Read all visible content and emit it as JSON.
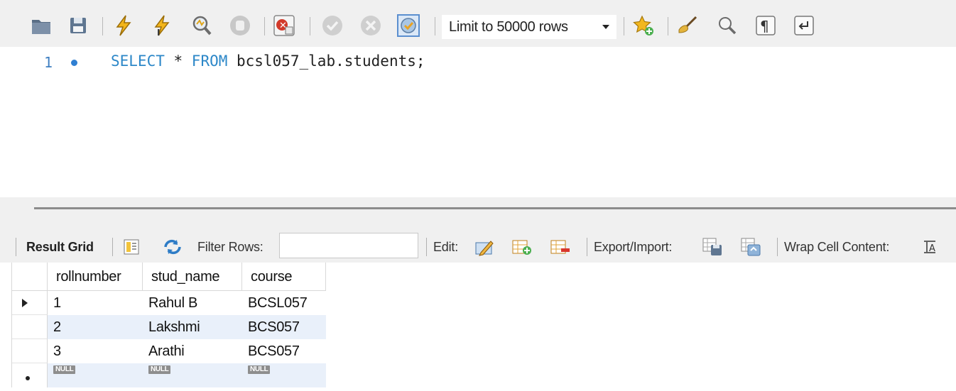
{
  "toolbar": {
    "icons": [
      "open-folder-icon",
      "save-icon",
      "execute-icon",
      "execute-current-icon",
      "explain-icon",
      "stop-icon",
      "toggle-error-icon",
      "commit-icon",
      "rollback-icon",
      "autocommit-icon",
      "add-snippet-icon",
      "beautify-icon",
      "find-icon",
      "invisible-chars-icon",
      "wrap-lines-icon"
    ],
    "limit_label": "Limit to 50000 rows"
  },
  "editor": {
    "line_number": "1",
    "code": {
      "kw1": "SELECT",
      "star": " * ",
      "kw2": "FROM",
      "rest": " bcsl057_lab.students;"
    }
  },
  "result_toolbar": {
    "result_grid_label": "Result Grid",
    "filter_label": "Filter Rows:",
    "filter_value": "",
    "edit_label": "Edit:",
    "export_label": "Export/Import:",
    "wrap_label": "Wrap Cell Content:"
  },
  "grid": {
    "columns": [
      "rollnumber",
      "stud_name",
      "course"
    ],
    "rows": [
      [
        "1",
        "Rahul B",
        "BCSL057"
      ],
      [
        "2",
        "Lakshmi",
        "BCS057"
      ],
      [
        "3",
        "Arathi",
        "BCS057"
      ]
    ],
    "null_label": "NULL"
  },
  "colors": {
    "keyword": "#2c87c8",
    "line_number": "#3f7fc1",
    "alt_row": "#e9f0fa",
    "toolbar_bg": "#f0f0f0"
  }
}
